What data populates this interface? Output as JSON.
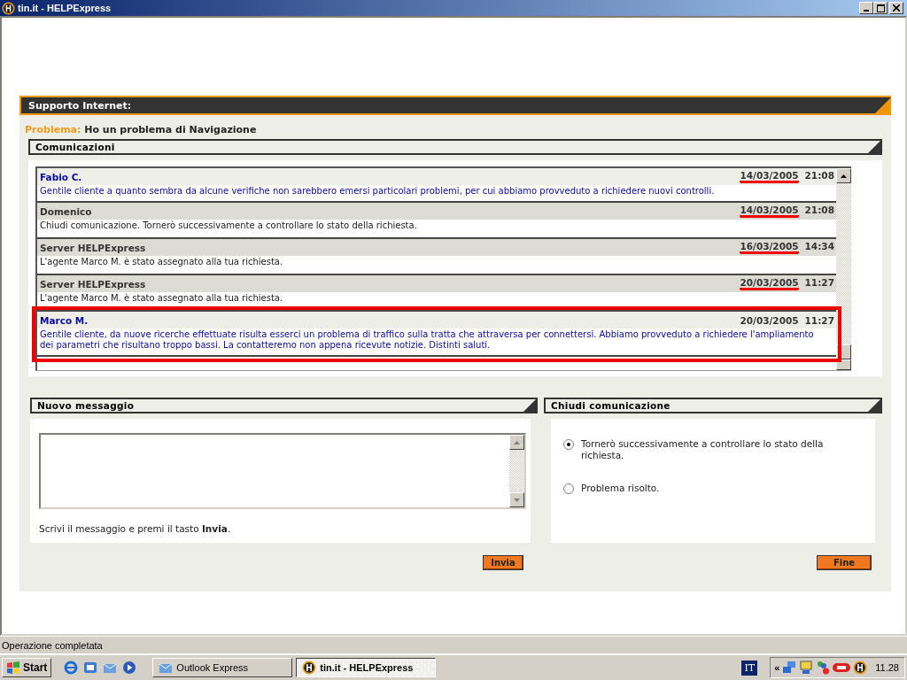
{
  "window": {
    "title": "tin.it - HELPExpress"
  },
  "header": {
    "title": "Supporto Internet:"
  },
  "problem": {
    "label": "Problema:",
    "value": "Ho un problema di Navigazione"
  },
  "communications": {
    "title": "Comunicazioni",
    "messages": [
      {
        "kind": "agent",
        "author": "Fabio C.",
        "date": "14/03/2005",
        "time": "21:08",
        "date_marked": true,
        "highlighted": false,
        "text": "Gentile cliente a quanto sembra da alcune verifiche non sarebbero emersi particolari problemi, per cui abbiamo provveduto a richiedere nuovi controlli."
      },
      {
        "kind": "user",
        "author": "Domenico",
        "date": "14/03/2005",
        "time": "21:08",
        "date_marked": true,
        "highlighted": false,
        "text": "Chiudi comunicazione. Tornerò successivamente a controllare lo stato della richiesta."
      },
      {
        "kind": "system",
        "author": "Server HELPExpress",
        "date": "16/03/2005",
        "time": "14:34",
        "date_marked": true,
        "highlighted": false,
        "text": "L'agente Marco M. è stato assegnato alla tua richiesta."
      },
      {
        "kind": "system",
        "author": "Server HELPExpress",
        "date": "20/03/2005",
        "time": "11:27",
        "date_marked": true,
        "highlighted": false,
        "text": "L'agente Marco M. è stato assegnato alla tua richiesta."
      },
      {
        "kind": "agent",
        "author": "Marco M.",
        "date": "20/03/2005",
        "time": "11:27",
        "date_marked": false,
        "highlighted": true,
        "text": "Gentile cliente, da nuove ricerche effettuate risulta esserci un problema di traffico sulla tratta che attraversa per connettersi. Abbiamo provveduto a richiedere l'ampliamento dei parametri che risultano troppo bassi. La contatteremo non appena ricevute notizie. Distinti saluti."
      }
    ]
  },
  "new_message": {
    "title": "Nuovo messaggio",
    "hint": "Scrivi il messaggio e premi il tasto **Invia**.",
    "button": "Invia"
  },
  "close_panel": {
    "title": "Chiudi comunicazione",
    "options": [
      {
        "label": "Tornerò successivamente a controllare lo stato della richiesta.",
        "selected": true
      },
      {
        "label": "Problema risolto.",
        "selected": false
      }
    ],
    "button": "Fine"
  },
  "status_bar": {
    "text": "Operazione completata"
  },
  "taskbar": {
    "start": "Start",
    "tasks": [
      {
        "label": "Outlook Express",
        "selected": false
      },
      {
        "label": "tin.it - HELPExpress",
        "selected": true
      }
    ],
    "language": "IT",
    "tray_toggle": "«",
    "clock": "11.28"
  }
}
